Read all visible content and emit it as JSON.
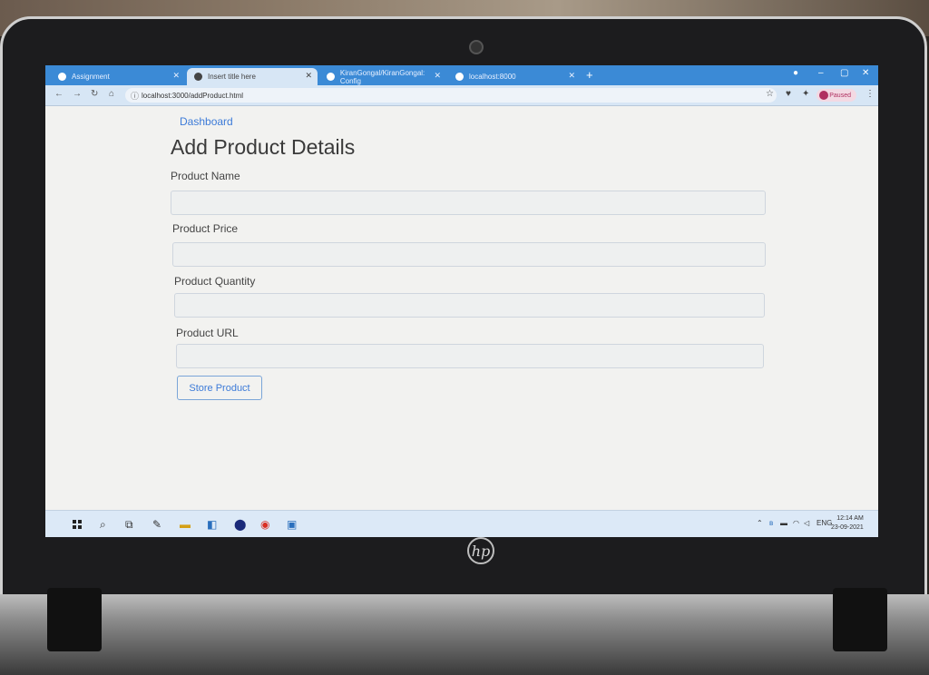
{
  "browser": {
    "tabs": [
      {
        "label": "Assignment",
        "active": false
      },
      {
        "label": "Insert title here",
        "active": true
      },
      {
        "label": "KiranGongal/KiranGongal: Config",
        "active": false
      },
      {
        "label": "localhost:8000",
        "active": false
      }
    ],
    "url": "localhost:3000/addProduct.html",
    "profile_status": "Paused"
  },
  "page": {
    "dashboard_link": "Dashboard",
    "title": "Add Product Details",
    "fields": [
      {
        "label": "Product Name",
        "value": ""
      },
      {
        "label": "Product Price",
        "value": ""
      },
      {
        "label": "Product Quantity",
        "value": ""
      },
      {
        "label": "Product URL",
        "value": ""
      }
    ],
    "submit_label": "Store Product"
  },
  "taskbar": {
    "language": "ENG",
    "time": "12:14 AM",
    "date": "23-09-2021"
  },
  "colors": {
    "link": "#3d7bd8",
    "tab_bar": "#3b8ad6",
    "page_bg": "#f2f2f0"
  }
}
